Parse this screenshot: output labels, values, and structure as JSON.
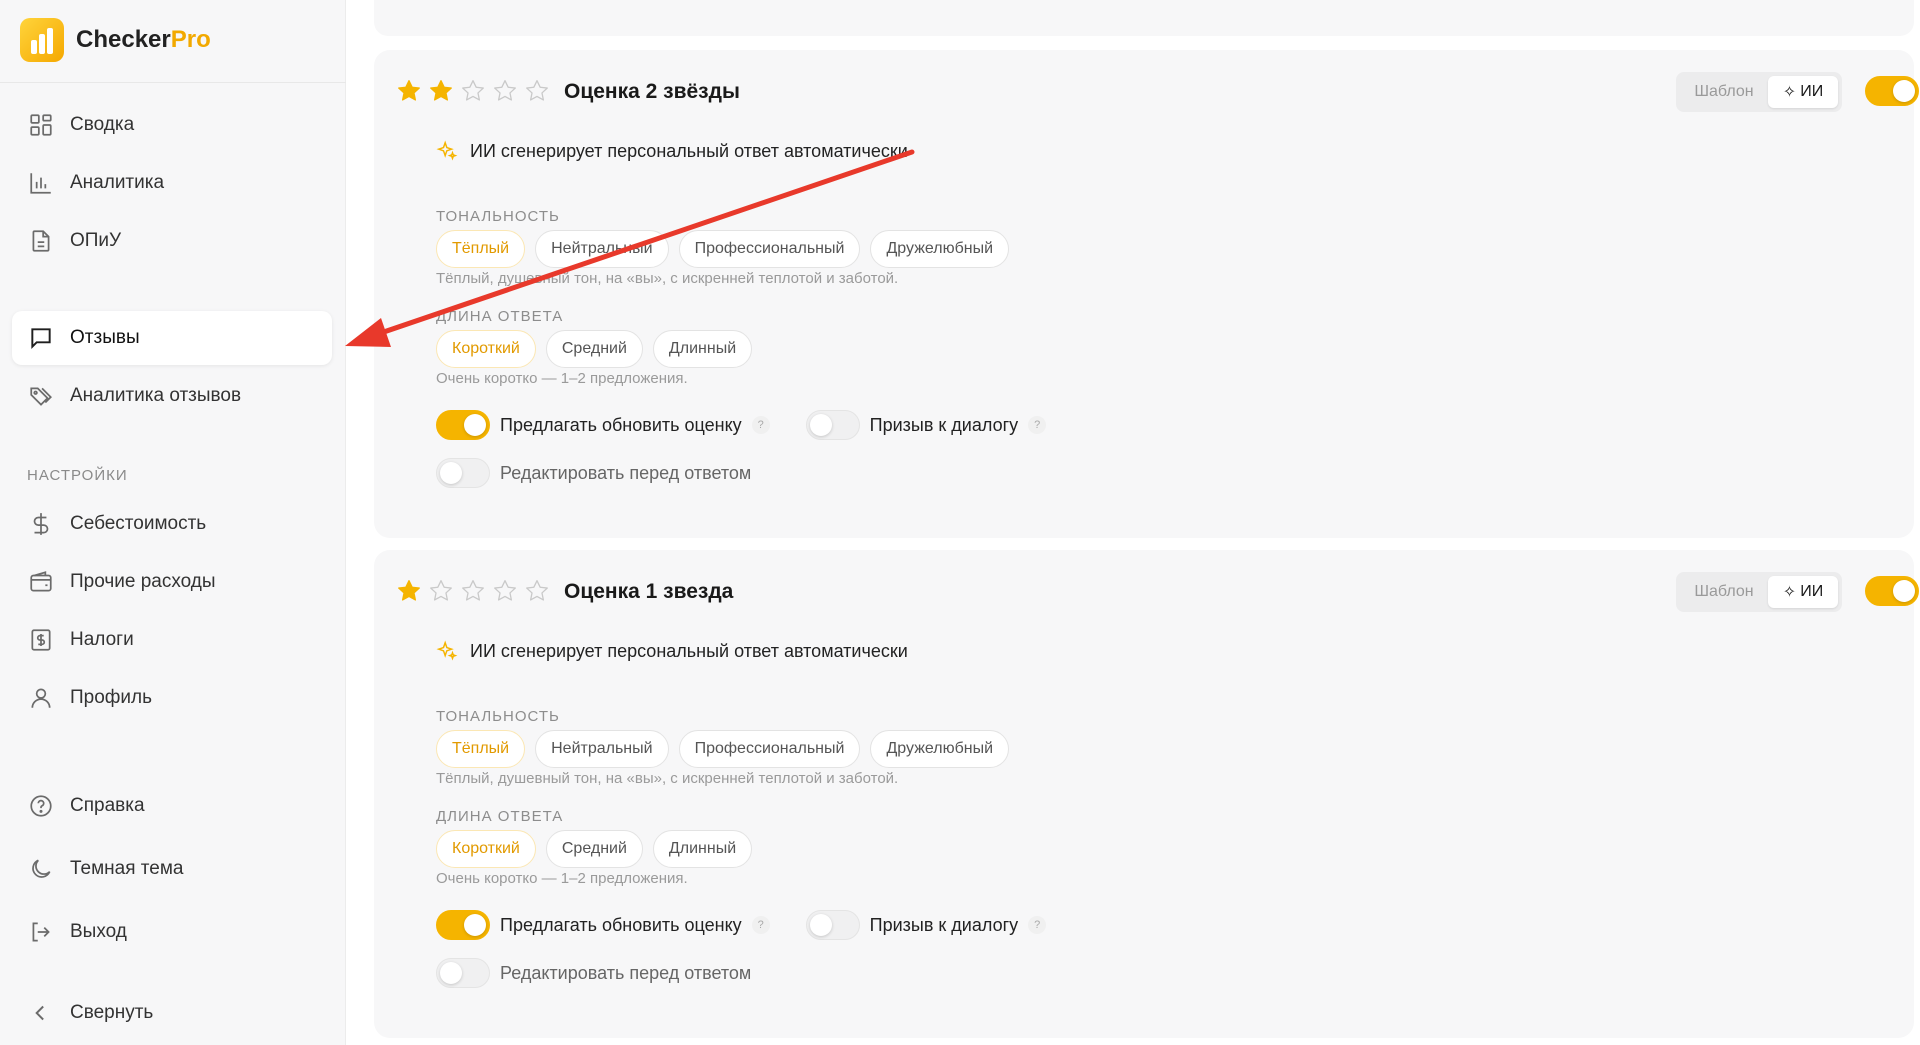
{
  "brand": {
    "name_main": "Checker",
    "name_accent": "Pro"
  },
  "sidebar": {
    "items": [
      {
        "label": "Сводка",
        "icon": "dashboard-icon"
      },
      {
        "label": "Аналитика",
        "icon": "bar-chart-icon"
      },
      {
        "label": "ОПиУ",
        "icon": "document-icon"
      },
      {
        "label": "Отзывы",
        "icon": "message-icon",
        "active": true
      },
      {
        "label": "Аналитика отзывов",
        "icon": "tags-icon"
      }
    ],
    "settings_title": "НАСТРОЙКИ",
    "settings_items": [
      {
        "label": "Себестоимость",
        "icon": "dollar-icon"
      },
      {
        "label": "Прочие расходы",
        "icon": "wallet-icon"
      },
      {
        "label": "Налоги",
        "icon": "receipt-icon"
      },
      {
        "label": "Профиль",
        "icon": "user-icon"
      }
    ],
    "bottom_items": [
      {
        "label": "Справка",
        "icon": "help-icon"
      },
      {
        "label": "Темная тема",
        "icon": "moon-icon"
      },
      {
        "label": "Выход",
        "icon": "logout-icon"
      },
      {
        "label": "Свернуть",
        "icon": "chevron-left-icon"
      }
    ]
  },
  "cards": [
    {
      "title": "Оценка 2 звёзды",
      "stars_filled": 2,
      "stars_total": 5,
      "mode_template": "Шаблон",
      "mode_ai": "ИИ",
      "enabled": true,
      "ai_text": "ИИ сгенерирует персональный ответ автоматически",
      "tone_label": "ТОНАЛЬНОСТЬ",
      "tones": [
        "Тёплый",
        "Нейтральный",
        "Профессиональный",
        "Дружелюбный"
      ],
      "tone_selected": "Тёплый",
      "tone_hint": "Тёплый, душевный тон, на «вы», с искренней теплотой и заботой.",
      "length_label": "ДЛИНА ОТВЕТА",
      "lengths": [
        "Короткий",
        "Средний",
        "Длинный"
      ],
      "length_selected": "Короткий",
      "length_hint": "Очень коротко — 1–2 предложения.",
      "opt_update": "Предлагать обновить оценку",
      "opt_update_on": true,
      "opt_dialog": "Призыв к диалогу",
      "opt_dialog_on": false,
      "opt_edit": "Редактировать перед ответом",
      "opt_edit_on": false,
      "help": "?"
    },
    {
      "title": "Оценка 1 звезда",
      "stars_filled": 1,
      "stars_total": 5,
      "mode_template": "Шаблон",
      "mode_ai": "ИИ",
      "enabled": true,
      "ai_text": "ИИ сгенерирует персональный ответ автоматически",
      "tone_label": "ТОНАЛЬНОСТЬ",
      "tones": [
        "Тёплый",
        "Нейтральный",
        "Профессиональный",
        "Дружелюбный"
      ],
      "tone_selected": "Тёплый",
      "tone_hint": "Тёплый, душевный тон, на «вы», с искренней теплотой и заботой.",
      "length_label": "ДЛИНА ОТВЕТА",
      "lengths": [
        "Короткий",
        "Средний",
        "Длинный"
      ],
      "length_selected": "Короткий",
      "length_hint": "Очень коротко — 1–2 предложения.",
      "opt_update": "Предлагать обновить оценку",
      "opt_update_on": true,
      "opt_dialog": "Призыв к диалогу",
      "opt_dialog_on": false,
      "opt_edit": "Редактировать перед ответом",
      "opt_edit_on": false,
      "help": "?"
    }
  ],
  "colors": {
    "accent": "#f5b400",
    "arrow": "#e8392b",
    "star_empty": "#c9c9c9"
  }
}
